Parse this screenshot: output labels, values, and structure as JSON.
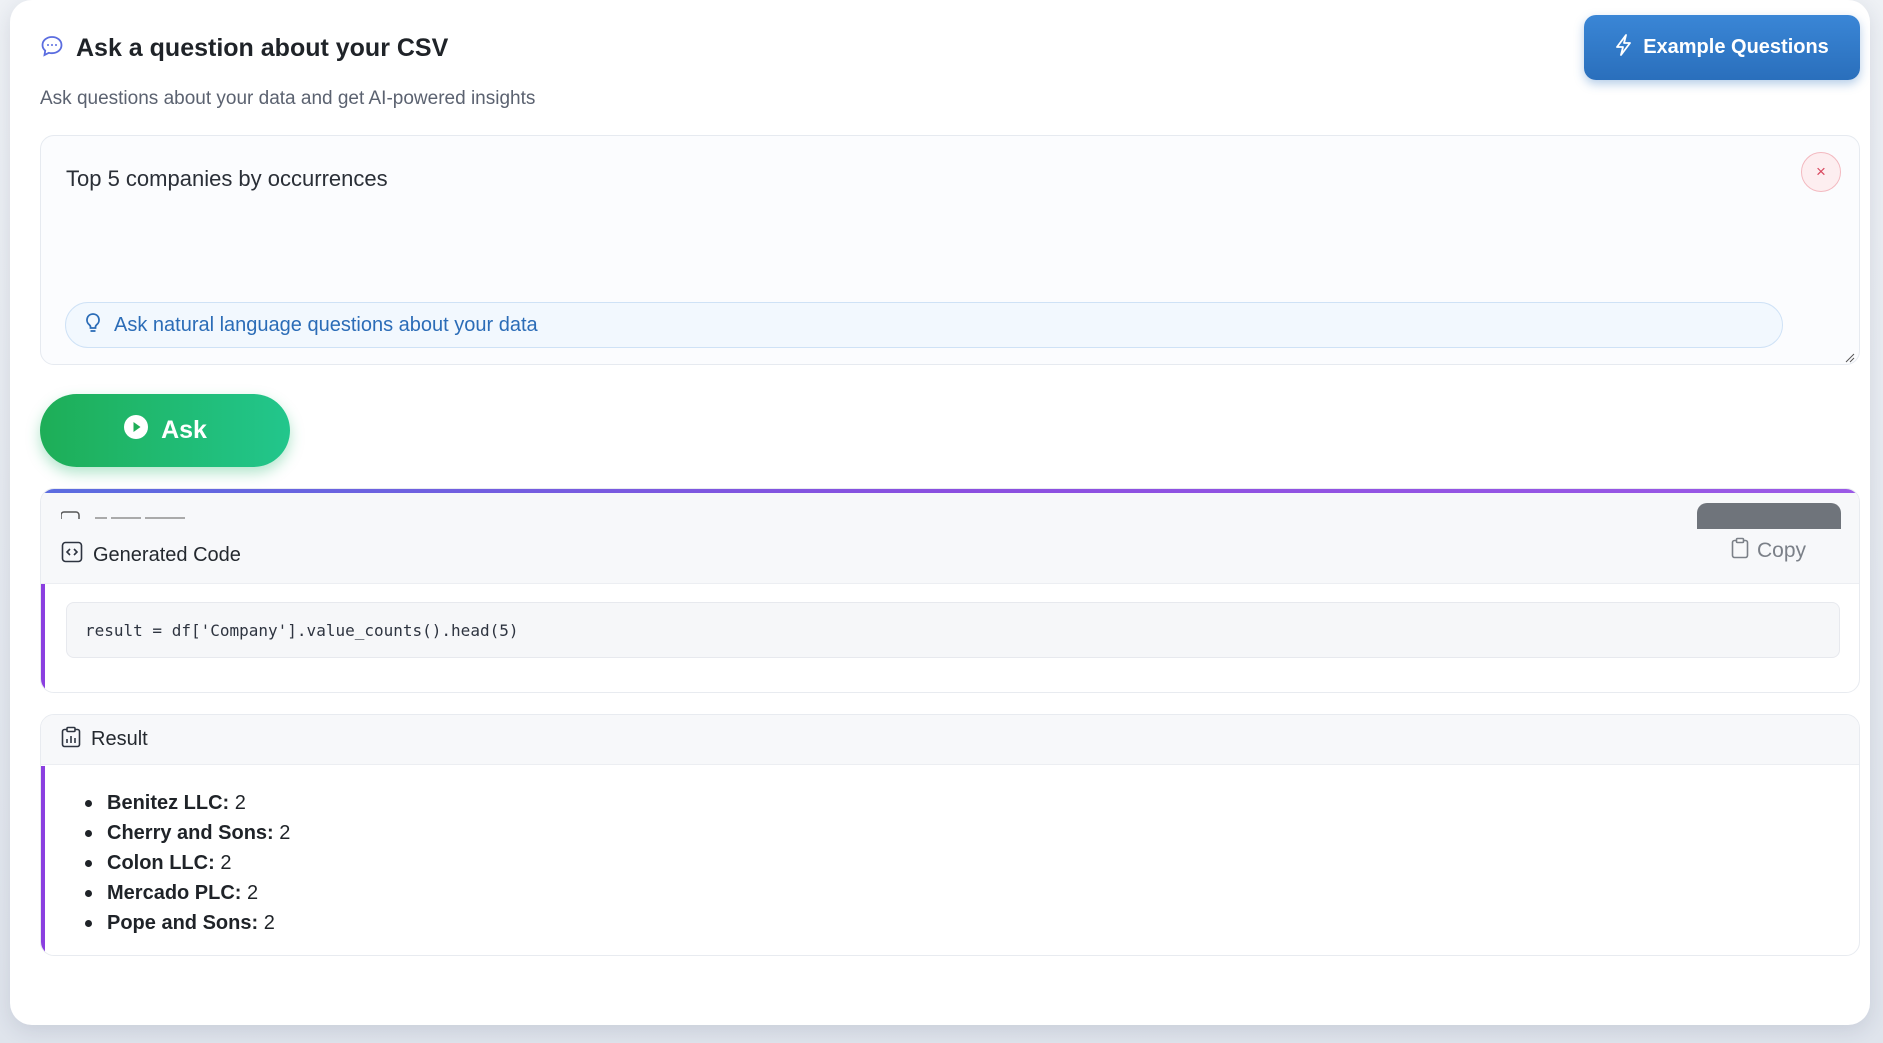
{
  "header": {
    "title": "Ask a question about your CSV",
    "subtitle": "Ask questions about your data and get AI-powered insights",
    "example_button": "Example Questions"
  },
  "question": {
    "value": "Top 5 companies by occurrences",
    "clear_symbol": "×",
    "hint": "Ask natural language questions about your data"
  },
  "ask_button": "Ask",
  "code_panel": {
    "title": "Generated Code",
    "copy_label": "Copy",
    "code": "result = df['Company'].value_counts().head(5)"
  },
  "result_panel": {
    "title": "Result",
    "items": [
      {
        "name": "Benitez LLC:",
        "value": "2"
      },
      {
        "name": "Cherry and Sons:",
        "value": "2"
      },
      {
        "name": "Colon LLC:",
        "value": "2"
      },
      {
        "name": "Mercado PLC:",
        "value": "2"
      },
      {
        "name": "Pope and Sons:",
        "value": "2"
      }
    ]
  },
  "colors": {
    "primary_blue": "#2a6fbc",
    "ask_green": "#1eae57",
    "accent_purple": "#8b3fe0",
    "hint_blue": "#2b6cb7"
  },
  "icons": {
    "header": "chat-bubble-icon",
    "example": "lightning-icon",
    "hint": "lightbulb-icon",
    "ask": "play-circle-icon",
    "code": "code-icon",
    "copy": "clipboard-icon",
    "result": "clipboard-chart-icon"
  }
}
